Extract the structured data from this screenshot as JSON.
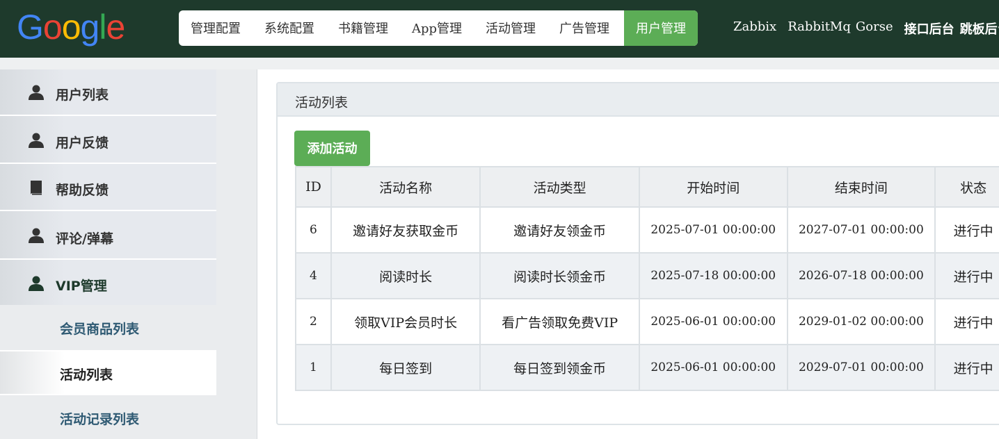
{
  "header": {
    "logo": [
      "G",
      "o",
      "o",
      "g",
      "l",
      "e"
    ],
    "nav": [
      "管理配置",
      "系统配置",
      "书籍管理",
      "App管理",
      "活动管理",
      "广告管理"
    ],
    "nav_active": "用户管理",
    "ext_links": [
      "Zabbix",
      "RabbitMq",
      "Gorse",
      "接口后台",
      "跳板后台"
    ]
  },
  "sidebar": {
    "items": [
      {
        "label": "用户列表",
        "icon": "user-icon"
      },
      {
        "label": "用户反馈",
        "icon": "user-icon"
      },
      {
        "label": "帮助反馈",
        "icon": "book-icon"
      },
      {
        "label": "评论/弹幕",
        "icon": "user-icon"
      },
      {
        "label": "VIP管理",
        "icon": "user-icon"
      }
    ],
    "sub_items": [
      "会员商品列表",
      "活动列表",
      "活动记录列表"
    ],
    "current": "活动列表"
  },
  "panel": {
    "title": "活动列表",
    "add_button": "添加活动",
    "columns": [
      "ID",
      "活动名称",
      "活动类型",
      "开始时间",
      "结束时间",
      "状态"
    ],
    "rows": [
      {
        "id": "6",
        "name": "邀请好友获取金币",
        "type": "邀请好友领金币",
        "start": "2025-07-01 00:00:00",
        "end": "2027-07-01 00:00:00",
        "status": "进行中"
      },
      {
        "id": "4",
        "name": "阅读时长",
        "type": "阅读时长领金币",
        "start": "2025-07-18 00:00:00",
        "end": "2026-07-18 00:00:00",
        "status": "进行中"
      },
      {
        "id": "2",
        "name": "领取VIP会员时长",
        "type": "看广告领取免费VIP",
        "start": "2025-06-01 00:00:00",
        "end": "2029-01-02 00:00:00",
        "status": "进行中"
      },
      {
        "id": "1",
        "name": "每日签到",
        "type": "每日签到领金币",
        "start": "2025-06-01 00:00:00",
        "end": "2029-07-01 00:00:00",
        "status": "进行中"
      }
    ]
  },
  "colors": {
    "header_bg": "#1e3a2c",
    "accent_green": "#5cad56"
  }
}
